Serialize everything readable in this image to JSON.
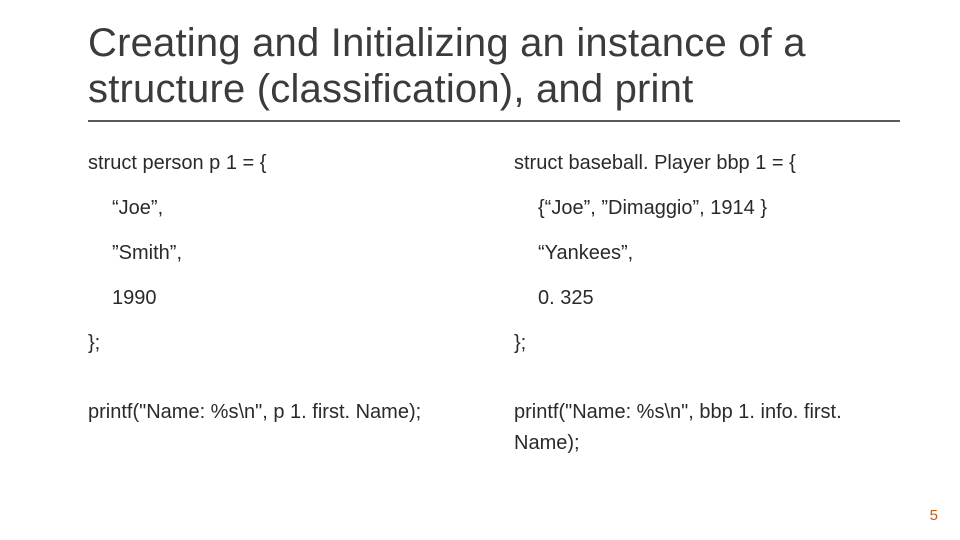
{
  "title_line1": "Creating and Initializing an instance of a",
  "title_line2": "structure (classification), and print",
  "left": {
    "l1": "struct person p 1 = {",
    "l2": "“Joe”,",
    "l3": "”Smith”,",
    "l4": "1990",
    "l5": "};",
    "l6": "printf(\"Name: %s\\n\", p 1. first. Name);"
  },
  "right": {
    "l1": "struct baseball. Player bbp 1 = {",
    "l2": "{“Joe”, ”Dimaggio”, 1914 }",
    "l3": "“Yankees”,",
    "l4": "0. 325",
    "l5": "};",
    "l6": "printf(\"Name: %s\\n\", bbp 1. info. first. Name);"
  },
  "page_number": "5"
}
